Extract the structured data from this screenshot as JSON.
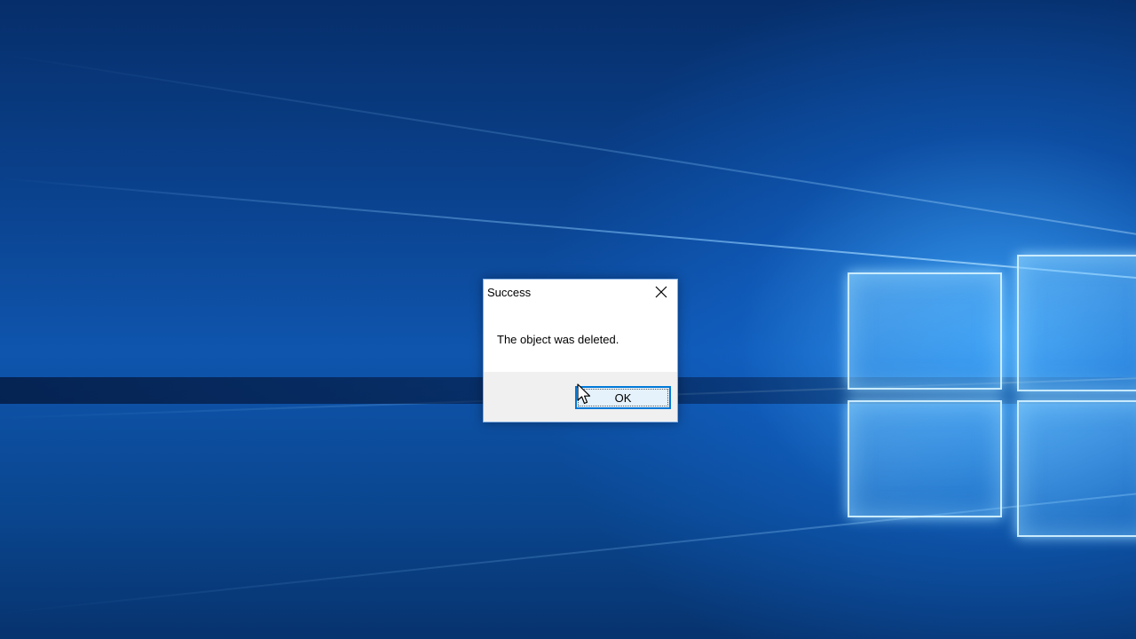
{
  "dialog": {
    "title": "Success",
    "message": "The object was deleted.",
    "ok_label": "OK",
    "close_icon": "close-icon"
  },
  "colors": {
    "accent": "#0078d7",
    "footer_bg": "#f0f0f0",
    "desktop_blue": "#0b4593"
  },
  "desktop": {
    "wallpaper": "windows-10-hero",
    "logo_icon": "windows-logo-icon"
  },
  "cursor": {
    "icon": "mouse-pointer-icon"
  }
}
